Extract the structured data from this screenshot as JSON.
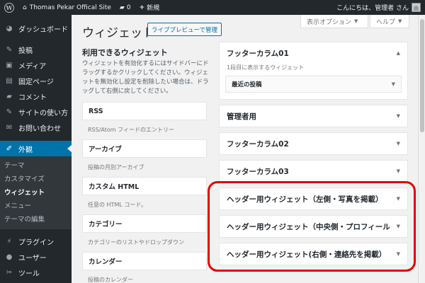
{
  "adminbar": {
    "site_name": "Thomas Pekar Offical Site",
    "comments_count": "0",
    "new_label": "新規",
    "greeting": "こんにちは、管理者 さん"
  },
  "sidebar": {
    "items_top": [
      {
        "label": "ダッシュボード",
        "icon": "dashboard-icon",
        "glyph": "◕"
      }
    ],
    "items_mid": [
      {
        "label": "投稿",
        "icon": "pin-icon",
        "glyph": "✎"
      },
      {
        "label": "メディア",
        "icon": "media-icon",
        "glyph": "▣"
      },
      {
        "label": "固定ページ",
        "icon": "page-icon",
        "glyph": "▤"
      },
      {
        "label": "コメント",
        "icon": "comment-icon",
        "glyph": "▰"
      },
      {
        "label": "サイトの使い方",
        "icon": "pin-icon",
        "glyph": "✎"
      },
      {
        "label": "お問い合わせ",
        "icon": "mail-icon",
        "glyph": "✉"
      }
    ],
    "current": {
      "label": "外観",
      "icon": "appearance-icon",
      "glyph": "✐"
    },
    "submenu": [
      "テーマ",
      "カスタマイズ",
      "ウィジェット",
      "メニュー",
      "テーマの編集"
    ],
    "submenu_active": "ウィジェット",
    "items_bottom": [
      {
        "label": "プラグイン",
        "icon": "plugin-icon",
        "glyph": "⚡"
      },
      {
        "label": "ユーザー",
        "icon": "user-icon",
        "glyph": "●"
      },
      {
        "label": "ツール",
        "icon": "tools-icon",
        "glyph": "✂"
      },
      {
        "label": "設定",
        "icon": "settings-icon",
        "glyph": "▦"
      }
    ]
  },
  "tabs": {
    "screen_options": "表示オプション",
    "help": "ヘルプ"
  },
  "header": {
    "title": "ウィジェット",
    "live_preview_button": "ライブプレビューで管理"
  },
  "available": {
    "title": "利用できるウィジェット",
    "description": "ウィジェットを有効化するにはサイドバーにドラッグするかクリックしてください。ウィジェットを無効化し設定を削除したい場合は、ドラッグして右側に戻してください。",
    "widgets": [
      {
        "name": "RSS",
        "desc": "RSS/Atom フィードのエントリー"
      },
      {
        "name": "アーカイブ",
        "desc": "投稿の月別アーカイブ"
      },
      {
        "name": "カスタム HTML",
        "desc": "任意の HTML コード。"
      },
      {
        "name": "カテゴリー",
        "desc": "カテゴリーのリストやドロップダウン"
      },
      {
        "name": "カレンダー",
        "desc": "投稿のカレンダー"
      }
    ]
  },
  "areas": {
    "footer01": {
      "title": "フッターカラム01",
      "desc": "1段目に表示するウィジェット",
      "inner_widget": "最近の投稿"
    },
    "admin": {
      "title": "管理者用"
    },
    "footer02": {
      "title": "フッターカラム02"
    },
    "footer03": {
      "title": "フッターカラム03"
    },
    "header_left": {
      "title": "ヘッダー用ウィジェット（左側・写真を掲載）"
    },
    "header_center": {
      "title": "ヘッダー用ウィジェット（中央側・プロフィール）"
    },
    "header_right": {
      "title": "ヘッダー用ウィジェット(右側・連絡先を掲載）"
    }
  },
  "colors": {
    "admin_bg": "#23282d",
    "accent": "#0073aa",
    "highlight": "#e50000"
  }
}
